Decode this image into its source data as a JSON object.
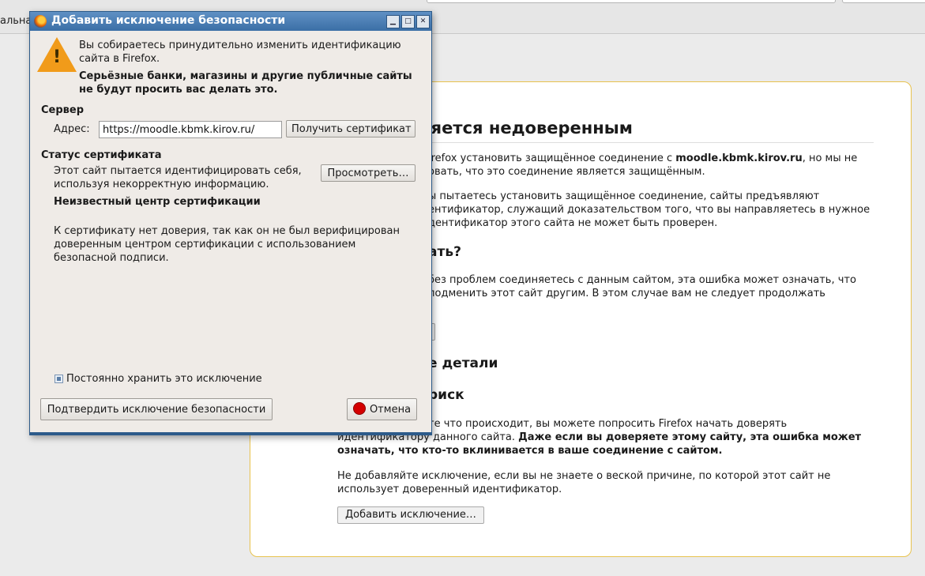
{
  "browser": {
    "left_label": "альна"
  },
  "error_page": {
    "title": "нение является недоверенным",
    "p1_a": "irefox установить защищённое соединение с ",
    "p1_host": "moodle.kbmk.kirov.ru",
    "p1_b": ", но мы не",
    "p1_c": "овать, что это соединение является защищённым.",
    "p2_a": "ы пытаетесь установить защищённое соединение, сайты предъявляют",
    "p2_b": "ентификатор, служащий доказательством того, что вы направляетесь в нужное",
    "p2_c": "дентификатор этого сайта не может быть проверен.",
    "h_what": "ать?",
    "p3_a": "без проблем соединяетесь с данным сайтом, эта ошибка может означать, что",
    "p3_b": "подменить этот сайт другим. В этом случае вам не следует продолжать",
    "get_me_out_button": "!",
    "h_details": "е детали",
    "h_risk": "риск",
    "p4_a": "те что происходит, вы можете попросить Firefox начать доверять",
    "p4_b": "идентификатору данного сайта. ",
    "p4_b_bold": "Даже если вы доверяете этому сайту, эта ошибка может",
    "p4_c_bold": "означать, что кто-то вклинивается в ваше соединение с сайтом.",
    "p5_a": "Не добавляйте исключение, если вы не знаете о веской причине, по которой этот сайт не",
    "p5_b": "использует доверенный идентификатор.",
    "add_exception_button": "Добавить исключение…"
  },
  "dialog": {
    "title": "Добавить исключение безопасности",
    "warn_line1": "Вы собираетесь принудительно изменить идентификацию",
    "warn_line2": "сайта в Firefox.",
    "warn_bold1": "Серьёзные банки, магазины и другие публичные сайты",
    "warn_bold2": "не будут просить вас делать это.",
    "server_heading": "Сервер",
    "address_label": "Адрес:",
    "address_value": "https://moodle.kbmk.kirov.ru/",
    "get_cert_button": "Получить сертификат",
    "status_heading": "Статус сертификата",
    "status_line1": "Этот сайт пытается идентифицировать себя,",
    "status_line2": "используя некорректную информацию.",
    "view_button": "Просмотреть…",
    "issue_heading": "Неизвестный центр сертификации",
    "issue_line1": "К сертификату нет доверия, так как он не был верифицирован",
    "issue_line2": "доверенным центром сертификации с использованием",
    "issue_line3": "безопасной подписи.",
    "permanent_checkbox_label": "Постоянно хранить это исключение",
    "permanent_checked": true,
    "confirm_button": "Подтвердить исключение безопасности",
    "cancel_button": "Отмена"
  }
}
